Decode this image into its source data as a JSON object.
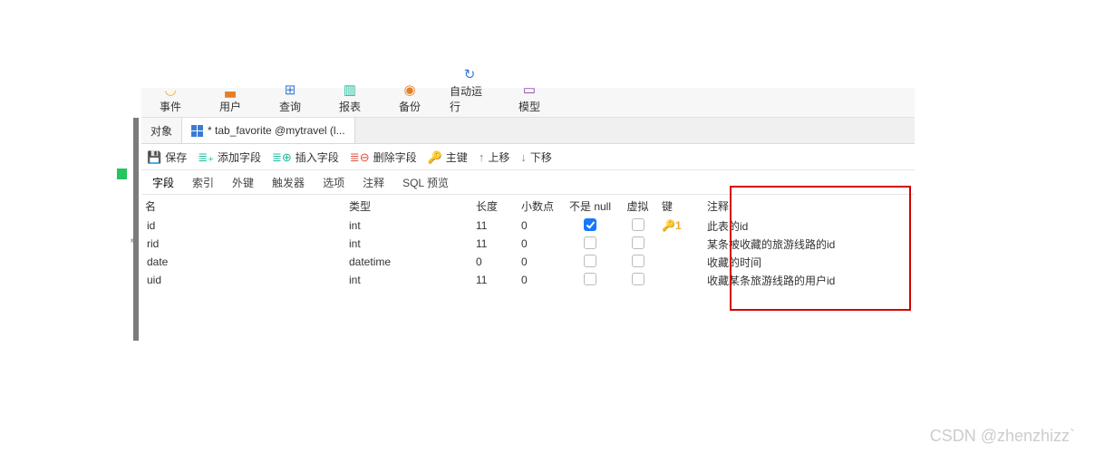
{
  "toolbar": [
    {
      "icon": "◡",
      "cls": "c-yellow",
      "label": "事件"
    },
    {
      "icon": "▃",
      "cls": "c-orange",
      "label": "用户"
    },
    {
      "icon": "⊞",
      "cls": "c-blue",
      "label": "查询"
    },
    {
      "icon": "▥",
      "cls": "c-teal",
      "label": "报表"
    },
    {
      "icon": "◉",
      "cls": "c-orange",
      "label": "备份"
    },
    {
      "icon": "↻",
      "cls": "c-blue",
      "label": "自动运行"
    },
    {
      "icon": "▭",
      "cls": "c-purple",
      "label": "模型"
    }
  ],
  "tabs": {
    "objects": "对象",
    "active": "* tab_favorite @mytravel (l..."
  },
  "design": {
    "save": "保存",
    "addField": "添加字段",
    "insertField": "插入字段",
    "deleteField": "删除字段",
    "primaryKey": "主键",
    "moveUp": "上移",
    "moveDown": "下移"
  },
  "subtabs": [
    "字段",
    "索引",
    "外键",
    "触发器",
    "选项",
    "注释",
    "SQL 预览"
  ],
  "columns": {
    "name": "名",
    "type": "类型",
    "length": "长度",
    "decimal": "小数点",
    "notnull": "不是 null",
    "virtual": "虚拟",
    "key": "键",
    "comment": "注释"
  },
  "rows": [
    {
      "name": "id",
      "type": "int",
      "len": "11",
      "dec": "0",
      "nn": true,
      "virt": false,
      "key": "🔑1",
      "comment": "此表的id"
    },
    {
      "name": "rid",
      "type": "int",
      "len": "11",
      "dec": "0",
      "nn": false,
      "virt": false,
      "key": "",
      "comment": "某条被收藏的旅游线路的id",
      "marker": "ˣ"
    },
    {
      "name": "date",
      "type": "datetime",
      "len": "0",
      "dec": "0",
      "nn": false,
      "virt": false,
      "key": "",
      "comment": "收藏的时间"
    },
    {
      "name": "uid",
      "type": "int",
      "len": "11",
      "dec": "0",
      "nn": false,
      "virt": false,
      "key": "",
      "comment": "收藏某条旅游线路的用户id"
    }
  ],
  "watermark": "CSDN @zhenzhizz`"
}
